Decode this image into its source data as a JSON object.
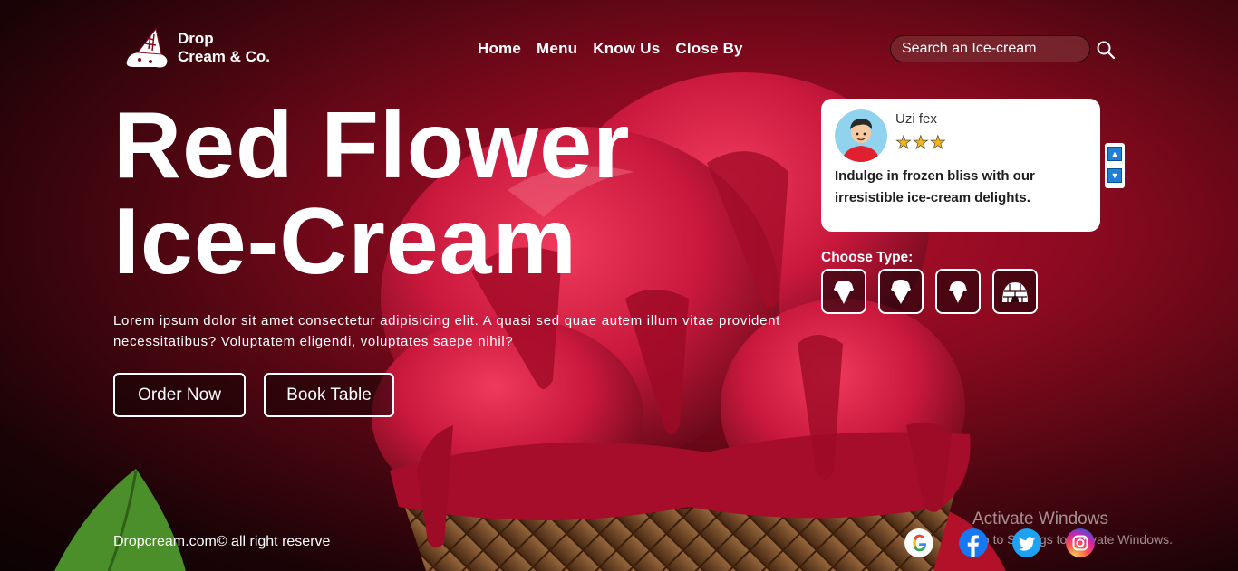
{
  "brand": {
    "line1": "Drop",
    "line2": "Cream & Co."
  },
  "nav": [
    "Home",
    "Menu",
    "Know Us",
    "Close By"
  ],
  "search": {
    "placeholder": "Search an Ice-cream"
  },
  "hero": {
    "title_line1": "Red Flower",
    "title_line2": "Ice-Cream",
    "description": "Lorem ipsum dolor sit amet consectetur adipisicing elit. A quasi sed quae autem illum vitae provident necessitatibus? Voluptatem eligendi, voluptates saepe nihil?",
    "order_label": "Order Now",
    "book_label": "Book Table"
  },
  "review": {
    "name": "Uzi fex",
    "stars": "★★★",
    "rating": 3,
    "text": "Indulge in frozen bliss with our irresistible ice-cream delights."
  },
  "choose": {
    "label": "Choose Type:",
    "types": [
      "cone-icon",
      "cone-icon",
      "cone-icon",
      "igloo-icon"
    ]
  },
  "footer": {
    "copyright": "Dropcream.com© all right reserve"
  },
  "socials": [
    "google-icon",
    "facebook-icon",
    "twitter-icon",
    "instagram-icon"
  ],
  "watermark": {
    "line1": "Activate Windows",
    "line2": "Go to Settings to activate Windows."
  },
  "colors": {
    "accent": "#b50e2c",
    "star": "#f2b51c",
    "arrow": "#1f7fd6"
  }
}
